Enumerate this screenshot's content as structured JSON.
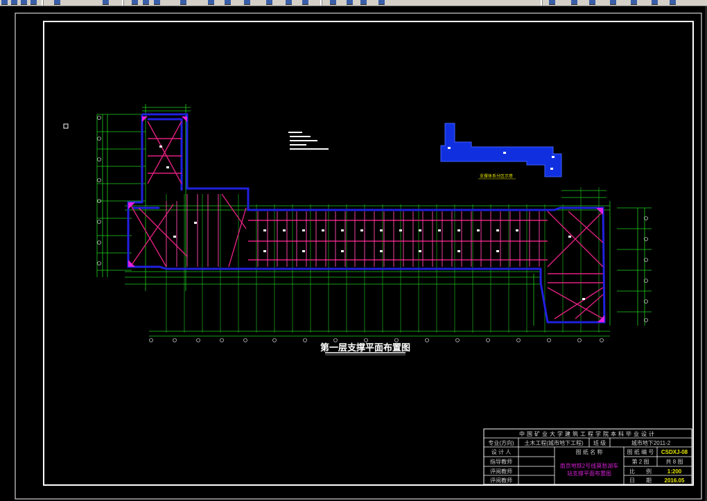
{
  "toolbar": {
    "icons": [
      "new-icon",
      "open-icon",
      "save-icon",
      "print-icon",
      "cut-icon",
      "copy-icon",
      "paste-icon",
      "undo-icon",
      "redo-icon",
      "pan-icon",
      "zoom-icon",
      "properties-icon",
      "layers-icon",
      "help-icon"
    ]
  },
  "drawing": {
    "title": "第一层支撑平面布置图",
    "key_plan_label": "支撑体系分区示意"
  },
  "title_block": {
    "header": "中国矿业大学建筑工程学院本科毕业设计",
    "major_label": "专业(方向)",
    "major_value": "土木工程(城市地下工程)",
    "class_label": "班 级",
    "class_value": "城市地下2011-2",
    "designer_label": "设 计 人",
    "drawing_name_label": "图 纸 名 称",
    "drawing_no_label": "图 纸 编 号",
    "drawing_no_value": "CSDXJ-08",
    "advisor_label": "指导教师",
    "reviewer1_label": "评阅教师",
    "reviewer2_label": "评阅教师",
    "drawing_name_value_line1": "南京地铁2号线莫愁湖车",
    "drawing_name_value_line2": "站支撑平面布置图",
    "sheet_no": "第 2 图",
    "sheet_total": "共 8 图",
    "scale_label": "比　　例",
    "scale_value": "1:200",
    "date_label": "日　　期",
    "date_value": "2016.05"
  },
  "colors": {
    "frame": "#ffffff",
    "wall": "#2020e0",
    "grid": "#20d020",
    "strut": "#e02080",
    "title_yellow": "#e8e800",
    "infill_blue": "#1030e0"
  }
}
